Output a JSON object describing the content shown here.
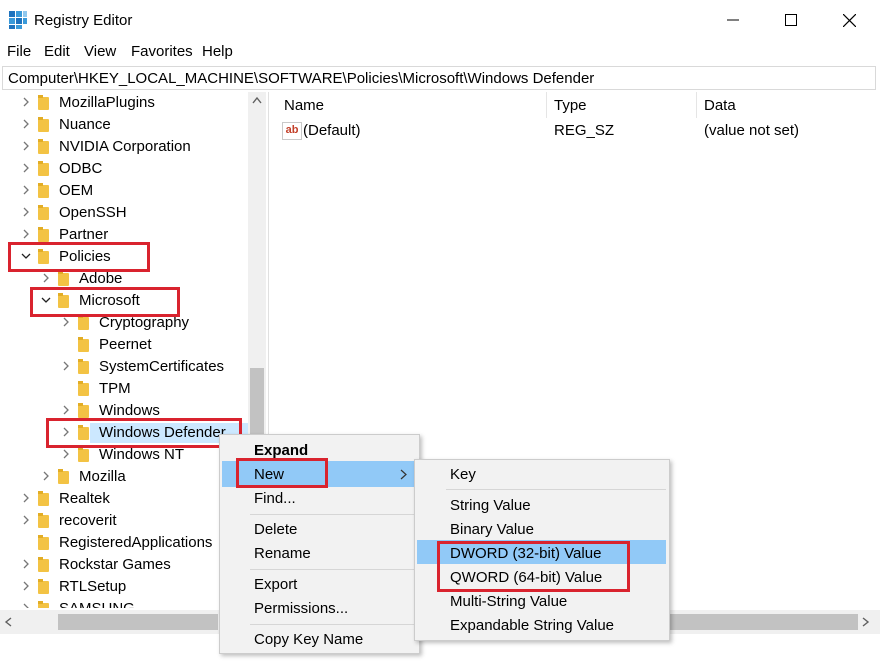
{
  "window": {
    "title": "Registry Editor",
    "minimize": "—",
    "maximize": "☐",
    "close": "✕"
  },
  "menubar": [
    "File",
    "Edit",
    "View",
    "Favorites",
    "Help"
  ],
  "address": "Computer\\HKEY_LOCAL_MACHINE\\SOFTWARE\\Policies\\Microsoft\\Windows Defender",
  "tree": [
    {
      "label": "MozillaPlugins",
      "level": 1,
      "state": "collapsed"
    },
    {
      "label": "Nuance",
      "level": 1,
      "state": "collapsed"
    },
    {
      "label": "NVIDIA Corporation",
      "level": 1,
      "state": "collapsed"
    },
    {
      "label": "ODBC",
      "level": 1,
      "state": "collapsed"
    },
    {
      "label": "OEM",
      "level": 1,
      "state": "collapsed"
    },
    {
      "label": "OpenSSH",
      "level": 1,
      "state": "collapsed"
    },
    {
      "label": "Partner",
      "level": 1,
      "state": "collapsed"
    },
    {
      "label": "Policies",
      "level": 1,
      "state": "expanded"
    },
    {
      "label": "Adobe",
      "level": 2,
      "state": "collapsed"
    },
    {
      "label": "Microsoft",
      "level": 2,
      "state": "expanded"
    },
    {
      "label": "Cryptography",
      "level": 3,
      "state": "collapsed"
    },
    {
      "label": "Peernet",
      "level": 3,
      "state": "leaf"
    },
    {
      "label": "SystemCertificates",
      "level": 3,
      "state": "collapsed"
    },
    {
      "label": "TPM",
      "level": 3,
      "state": "leaf"
    },
    {
      "label": "Windows",
      "level": 3,
      "state": "collapsed"
    },
    {
      "label": "Windows Defender",
      "level": 3,
      "state": "collapsed",
      "selected": true
    },
    {
      "label": "Windows NT",
      "level": 3,
      "state": "collapsed"
    },
    {
      "label": "Mozilla",
      "level": 2,
      "state": "collapsed"
    },
    {
      "label": "Realtek",
      "level": 1,
      "state": "collapsed"
    },
    {
      "label": "recoverit",
      "level": 1,
      "state": "collapsed"
    },
    {
      "label": "RegisteredApplications",
      "level": 1,
      "state": "leaf"
    },
    {
      "label": "Rockstar Games",
      "level": 1,
      "state": "collapsed"
    },
    {
      "label": "RTLSetup",
      "level": 1,
      "state": "collapsed"
    },
    {
      "label": "SAMSUNG",
      "level": 1,
      "state": "collapsed"
    }
  ],
  "list": {
    "columns": [
      "Name",
      "Type",
      "Data"
    ],
    "rows": [
      {
        "name": "(Default)",
        "type": "REG_SZ",
        "data": "(value not set)",
        "icon": "string-value-icon",
        "icon_text": "ab"
      }
    ]
  },
  "context_menu": {
    "items": [
      {
        "label": "Expand",
        "bold": true
      },
      {
        "label": "New",
        "submenu": true,
        "highlighted": true
      },
      {
        "label": "Find..."
      },
      {
        "label": "Delete"
      },
      {
        "label": "Rename"
      },
      {
        "label": "Export"
      },
      {
        "label": "Permissions..."
      },
      {
        "label": "Copy Key Name"
      }
    ]
  },
  "submenu": {
    "items": [
      {
        "label": "Key"
      },
      {
        "label": "String Value"
      },
      {
        "label": "Binary Value"
      },
      {
        "label": "DWORD (32-bit) Value",
        "highlighted": true
      },
      {
        "label": "QWORD (64-bit) Value"
      },
      {
        "label": "Multi-String Value"
      },
      {
        "label": "Expandable String Value"
      }
    ]
  },
  "colors": {
    "highlight": "#91c9f7",
    "selection": "#cce8ff",
    "annotation_red": "#d9232e",
    "folder": "#f3c344"
  }
}
